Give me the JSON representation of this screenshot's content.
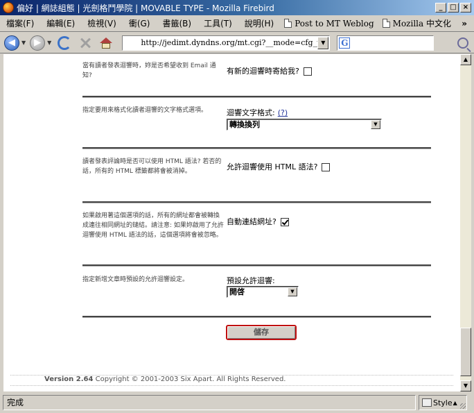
{
  "window": {
    "title": "偏好 | 網誌組態 | 光劍格鬥學院 | MOVABLE TYPE - Mozilla Firebird",
    "minimize": "_",
    "maximize": "□",
    "close": "×"
  },
  "menu": {
    "items": [
      "檔案(F)",
      "編輯(E)",
      "檢視(V)",
      "衝(G)",
      "書籤(B)",
      "工具(T)",
      "說明(H)"
    ],
    "bookmarks": [
      "Post to MT Weblog",
      "Mozilla 中文化"
    ],
    "more": "»"
  },
  "nav": {
    "url": "http://jedimt.dyndns.org/mt.cgi?__mode=cfg_prefs&blo",
    "search_value": ""
  },
  "settings": {
    "email_notify": {
      "description": "當有讀者發表迴響時，妳是否希望收到 Email 通知?",
      "label": "有新的迴響時寄給我?",
      "checked": false
    },
    "text_format": {
      "description": "指定要用來格式化讀者迴響的文字格式選項。",
      "label": "迴響文字格式:",
      "help": "(?)",
      "selected": "轉換換列"
    },
    "allow_html": {
      "description": "讀者發表評論時是否可以使用 HTML 語法? 若否的話，所有的 HTML 標籤都將會被消掉。",
      "label": "允許迴響使用 HTML 語法?",
      "checked": false
    },
    "autolink": {
      "description": "如果啟用著這個選項的話，所有的網址都會被轉換成連往相同網址的鏈結。請注意: 如果妳啟用了允許迴響使用 HTML 語法的話，這個選項將會被忽略。",
      "label": "自動連結網址?",
      "checked": true
    },
    "default_comments": {
      "description": "指定新增文章時預設的允許迴響設定。",
      "label": "預設允許迴響:",
      "selected": "開啓"
    }
  },
  "save_label": "儲存",
  "footer": {
    "version": "Version 2.64",
    "copyright": "Copyright © 2001-2003 Six Apart. All Rights Reserved."
  },
  "status": {
    "text": "完成",
    "style_label": "Style"
  },
  "colors": {
    "title_start": "#0a246a",
    "title_end": "#a6caf0",
    "save_border": "#c01010"
  }
}
